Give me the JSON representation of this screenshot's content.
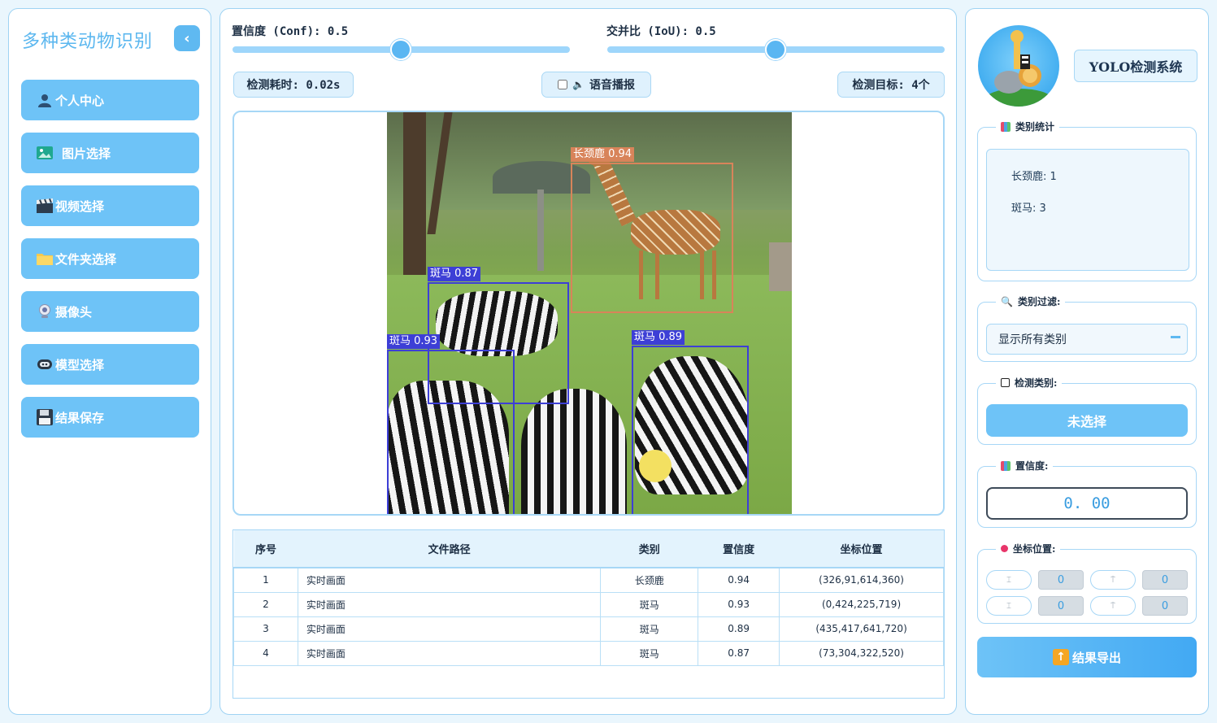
{
  "app": {
    "title": "多种类动物识别",
    "collapse_icon": "chevron-left-icon"
  },
  "nav": [
    {
      "label": "个人中心",
      "icon": "user-icon"
    },
    {
      "label": "图片选择",
      "icon": "image-icon"
    },
    {
      "label": "视频选择",
      "icon": "clapperboard-icon"
    },
    {
      "label": "文件夹选择",
      "icon": "folder-icon"
    },
    {
      "label": "摄像头",
      "icon": "webcam-icon"
    },
    {
      "label": "模型选择",
      "icon": "model-icon"
    },
    {
      "label": "结果保存",
      "icon": "floppy-disk-icon"
    }
  ],
  "controls": {
    "conf_label": "置信度 (Conf): 0.5",
    "conf_value": 0.5,
    "iou_label": "交并比 (IoU): 0.5",
    "iou_value": 0.5,
    "time_label": "检测耗时: 0.02s",
    "voice_label": "语音播报",
    "target_label": "检测目标: 4个"
  },
  "detections_overlay": [
    {
      "label": "长颈鹿 0.94",
      "color": "#d8845a"
    },
    {
      "label": "斑马 0.87",
      "color": "#3d3fd6"
    },
    {
      "label": "斑马 0.93",
      "color": "#3d3fd6"
    },
    {
      "label": "斑马 0.89",
      "color": "#3d3fd6"
    }
  ],
  "table": {
    "headers": [
      "序号",
      "文件路径",
      "类别",
      "置信度",
      "坐标位置"
    ],
    "rows": [
      [
        "1",
        "实时画面",
        "长颈鹿",
        "0.94",
        "(326,91,614,360)"
      ],
      [
        "2",
        "实时画面",
        "斑马",
        "0.93",
        "(0,424,225,719)"
      ],
      [
        "3",
        "实时画面",
        "斑马",
        "0.89",
        "(435,417,641,720)"
      ],
      [
        "4",
        "实时画面",
        "斑马",
        "0.87",
        "(73,304,322,520)"
      ]
    ]
  },
  "right": {
    "system_title": "YOLO检测系统",
    "stats_title": "类别统计",
    "stats": [
      "长颈鹿: 1",
      "斑马: 3"
    ],
    "filter_title": "类别过滤:",
    "filter_value": "显示所有类别",
    "detect_class_title": "检测类别:",
    "detect_class_value": "未选择",
    "confidence_title": "置信度:",
    "confidence_value": "0. 00",
    "coord_title": "坐标位置:",
    "coords": {
      "xmin": "0",
      "ymin": "0",
      "xmax": "0",
      "ymax": "0"
    },
    "export_label": "结果导出"
  },
  "colors": {
    "accent": "#6ec3f7",
    "border": "#a7d7f6",
    "giraffe_box": "#d8845a",
    "zebra_box": "#3d3fd6"
  }
}
